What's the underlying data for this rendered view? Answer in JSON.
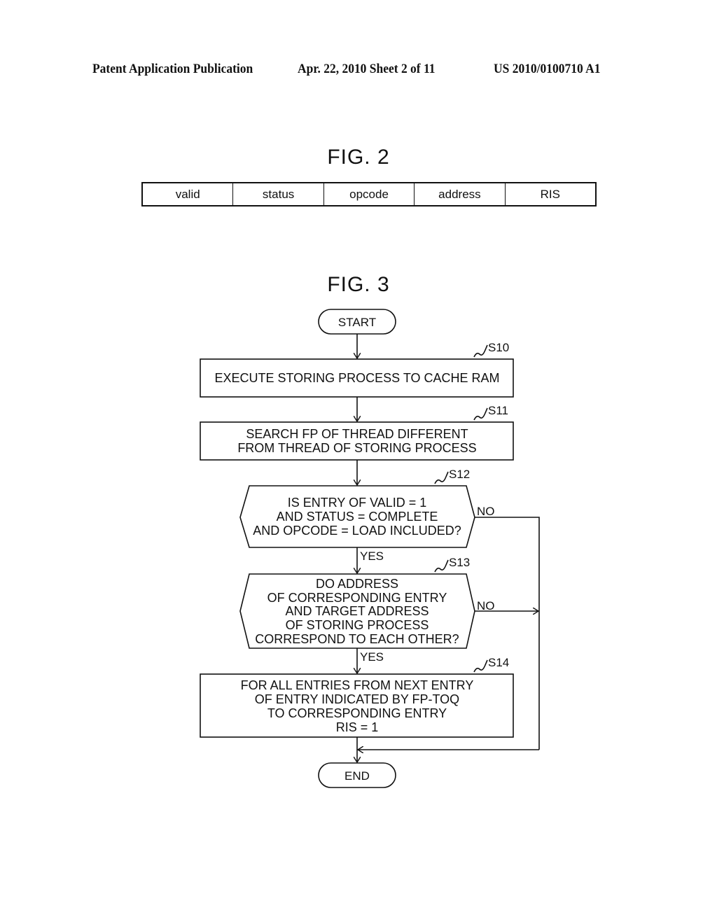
{
  "header": {
    "publication": "Patent Application Publication",
    "date_sheet": "Apr. 22, 2010  Sheet 2 of 11",
    "number": "US 2010/0100710 A1"
  },
  "fig2": {
    "title": "FIG. 2",
    "fields": [
      "valid",
      "status",
      "opcode",
      "address",
      "RIS"
    ]
  },
  "fig3": {
    "title": "FIG. 3",
    "start": "START",
    "end": "END",
    "steps": {
      "s10": {
        "label": "S10",
        "lines": [
          "EXECUTE STORING PROCESS TO CACHE RAM"
        ]
      },
      "s11": {
        "label": "S11",
        "lines": [
          "SEARCH FP OF THREAD DIFFERENT",
          "FROM THREAD OF STORING PROCESS"
        ]
      },
      "s12": {
        "label": "S12",
        "lines": [
          "IS ENTRY OF VALID = 1",
          "AND STATUS = COMPLETE",
          "AND OPCODE = LOAD INCLUDED?"
        ],
        "yes": "YES",
        "no": "NO"
      },
      "s13": {
        "label": "S13",
        "lines": [
          "DO ADDRESS",
          "OF CORRESPONDING ENTRY",
          "AND TARGET ADDRESS",
          "OF STORING PROCESS",
          "CORRESPOND TO EACH OTHER?"
        ],
        "yes": "YES",
        "no": "NO"
      },
      "s14": {
        "label": "S14",
        "lines": [
          "FOR ALL ENTRIES FROM NEXT ENTRY",
          "OF ENTRY INDICATED BY FP-TOQ",
          "TO CORRESPONDING ENTRY",
          "RIS = 1"
        ]
      }
    }
  }
}
